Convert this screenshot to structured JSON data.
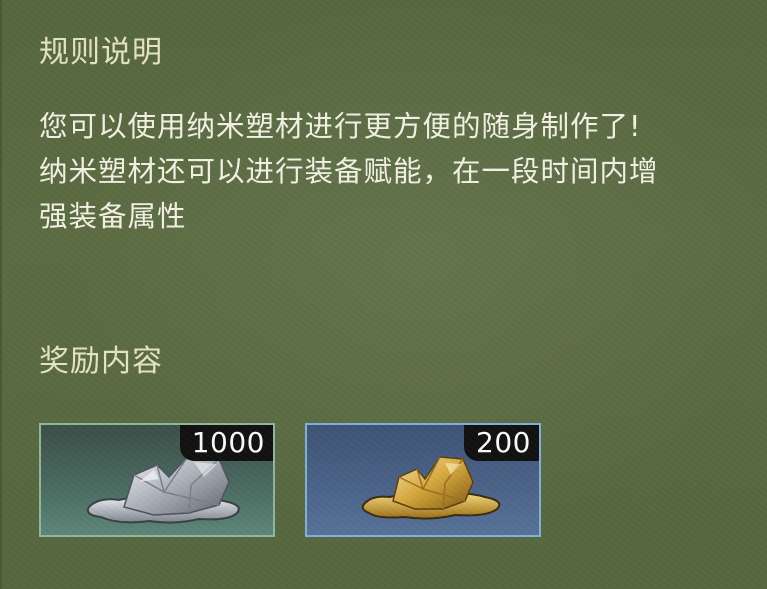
{
  "rules": {
    "title": "规则说明",
    "paragraph1": "您可以使用纳米塑材进行更方便的随身制作了!",
    "paragraph2": "纳米塑材还可以进行装备赋能，在一段时间内增强装备属性"
  },
  "rewards": {
    "title": "奖励内容",
    "items": [
      {
        "icon": "silver-nano-plastic-icon",
        "quantity": "1000",
        "color": "#c9ccd2"
      },
      {
        "icon": "gold-nano-plastic-icon",
        "quantity": "200",
        "color": "#d6a93a"
      }
    ]
  }
}
